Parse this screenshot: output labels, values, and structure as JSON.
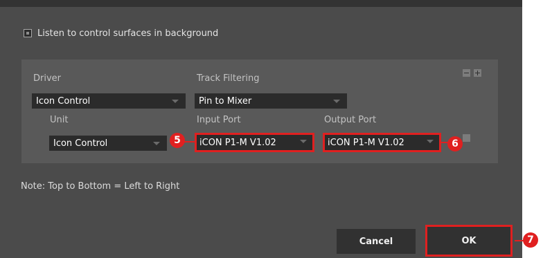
{
  "options": {
    "listen_label": "Listen to control surfaces in background",
    "listen_checked": false
  },
  "labels": {
    "driver": "Driver",
    "track_filtering": "Track Filtering",
    "unit": "Unit",
    "input_port": "Input Port",
    "output_port": "Output Port"
  },
  "dropdowns": {
    "driver": "Icon Control",
    "track_filtering": "Pin to Mixer",
    "unit": "Icon Control",
    "input_port": "iCON P1-M V1.02",
    "output_port": "iCON P1-M V1.02"
  },
  "note": "Note: Top to Bottom = Left to Right",
  "buttons": {
    "cancel": "Cancel",
    "ok": "OK"
  },
  "callouts": [
    "5",
    "6",
    "7"
  ],
  "colors": {
    "highlight": "#e02020",
    "dialog_bg": "#4b4b4b",
    "panel_bg": "#595959"
  }
}
